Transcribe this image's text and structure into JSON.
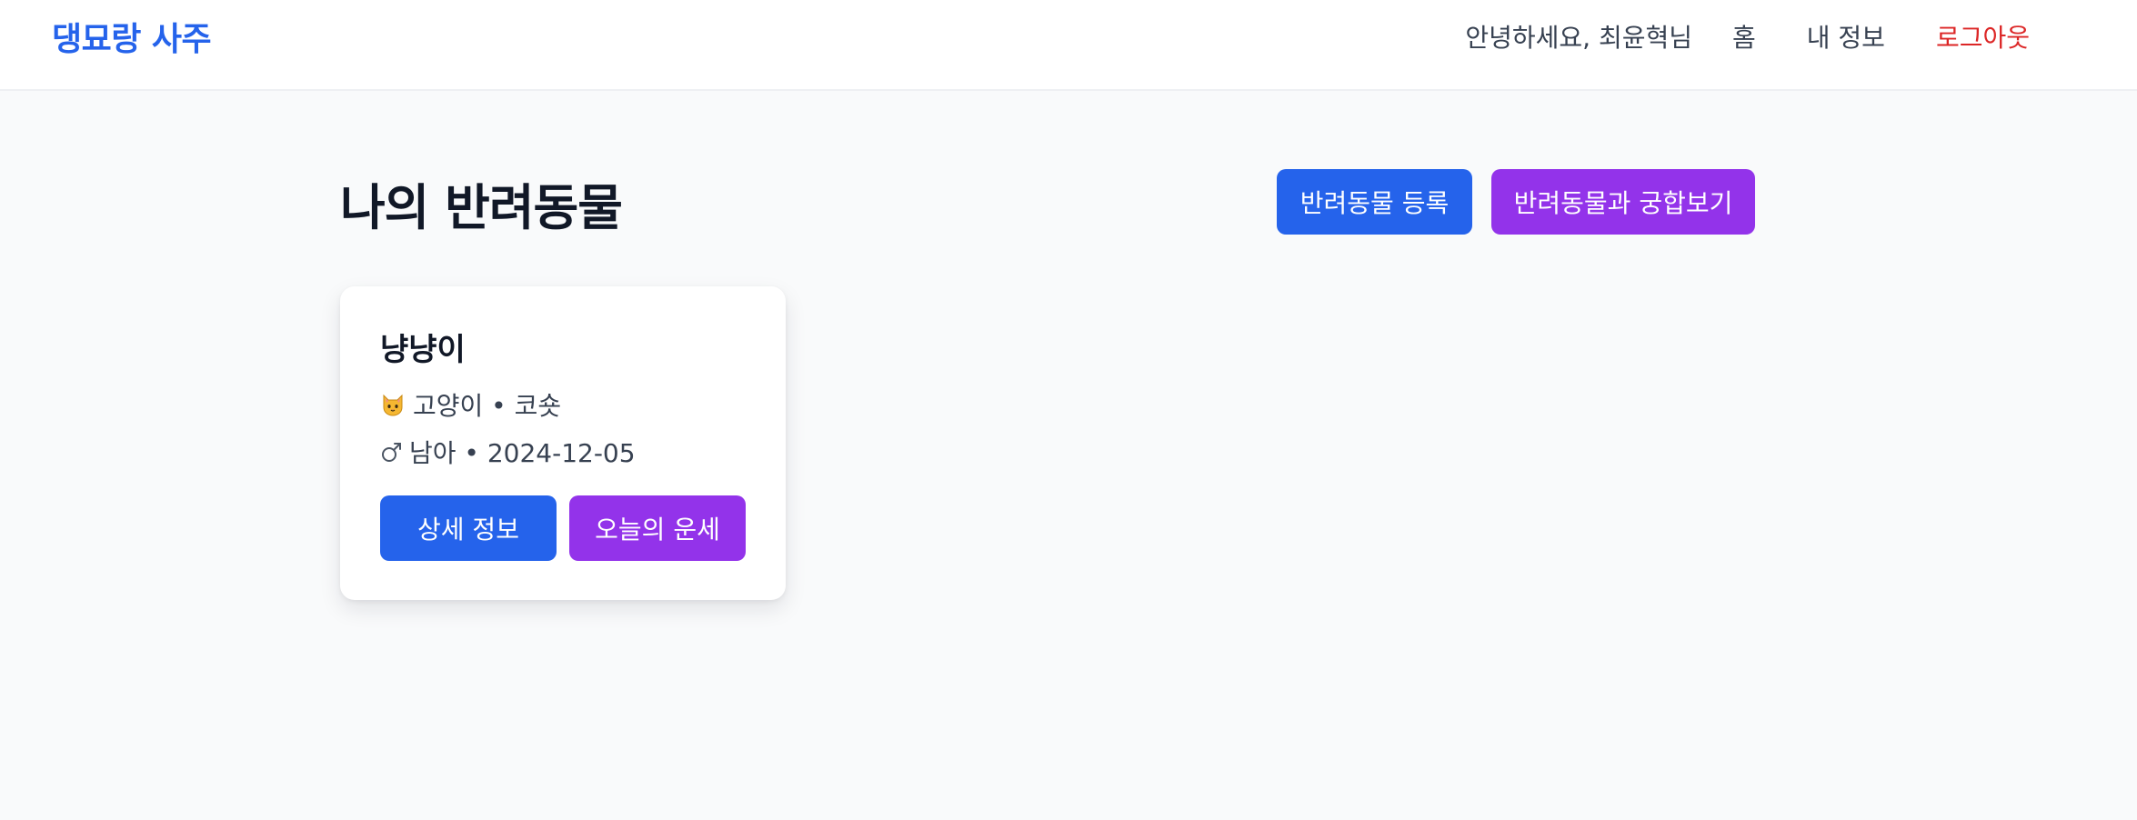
{
  "header": {
    "brand": "댕묘랑 사주",
    "greeting": "안녕하세요, 최윤혁님",
    "nav_home": "홈",
    "nav_profile": "내 정보",
    "nav_logout": "로그아웃"
  },
  "main": {
    "title": "나의 반려동물",
    "register_button": "반려동물 등록",
    "compat_button": "반려동물과 궁합보기"
  },
  "pets": [
    {
      "name": "냥냥이",
      "species_icon": "cat-face-icon",
      "species_line": "고양이 • 코숏",
      "gender_icon": "male-sign-icon",
      "gender_line": "남아 • 2024-12-05",
      "detail_button": "상세 정보",
      "fortune_button": "오늘의 운세"
    }
  ],
  "colors": {
    "brand": "#2563eb",
    "primary": "#2563eb",
    "secondary": "#9333ea",
    "logout": "#dc2626",
    "background": "#f9fafb"
  }
}
